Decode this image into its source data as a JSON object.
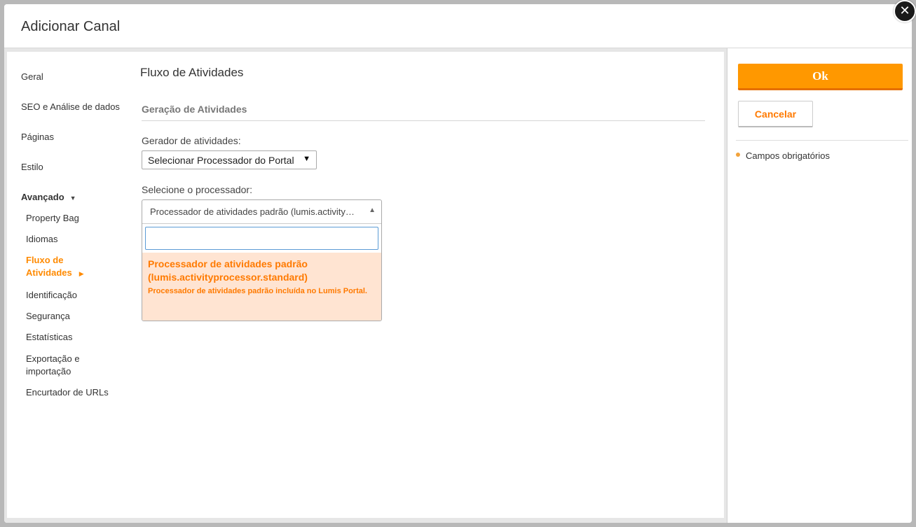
{
  "dialog": {
    "title": "Adicionar Canal",
    "close_symbol": "✕"
  },
  "nav": {
    "items": [
      {
        "label": "Geral"
      },
      {
        "label": "SEO e Análise de dados"
      },
      {
        "label": "Páginas"
      },
      {
        "label": "Estilo"
      }
    ],
    "group_label": "Avançado",
    "sub_items": [
      {
        "label": "Property Bag"
      },
      {
        "label": "Idiomas"
      },
      {
        "label": "Fluxo de Atividades",
        "active": true
      },
      {
        "label": "Identificação"
      },
      {
        "label": "Segurança"
      },
      {
        "label": "Estatísticas"
      },
      {
        "label": "Exportação e importação"
      },
      {
        "label": "Encurtador de URLs"
      }
    ]
  },
  "content": {
    "section_title": "Fluxo de Atividades",
    "subsection_title": "Geração de Atividades",
    "generator_label": "Gerador de atividades:",
    "generator_value": "Selecionar Processador do Portal",
    "processor_label": "Selecione o processador:",
    "processor_value": "Processador de atividades padrão (lumis.activity…",
    "search_value": "",
    "option_title": "Processador de atividades padrão (lumis.activityprocessor.standard)",
    "option_desc": "Processador de atividades padrão incluída no Lumis Portal."
  },
  "actions": {
    "ok_label": "Ok",
    "cancel_label": "Cancelar",
    "required_legend": "Campos obrigatórios"
  },
  "colors": {
    "accent": "#ff9800",
    "accent_text": "#ff7a00",
    "option_highlight": "#ffe4d2"
  },
  "icons": {
    "close": "close-icon",
    "group_caret": "caret-down-icon",
    "active_arrow": "arrow-right-icon",
    "select_arrow": "triangle-down-icon",
    "combo_arrow": "triangle-up-icon",
    "legend_dot": "dot-icon"
  }
}
